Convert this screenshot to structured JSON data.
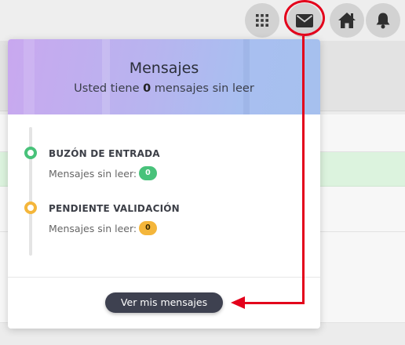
{
  "topbar": {
    "icons": [
      "apps-grid-icon",
      "envelope-icon",
      "home-icon",
      "bell-icon"
    ]
  },
  "messages_panel": {
    "title": "Mensajes",
    "subtitle_prefix": "Usted tiene ",
    "unread_count": "0",
    "subtitle_suffix": " mensajes sin leer",
    "items": [
      {
        "label": "BUZÓN DE ENTRADA",
        "unread_label": "Mensajes sin leer:",
        "count": "0",
        "color": "#48c27a"
      },
      {
        "label": "PENDIENTE VALIDACIÓN",
        "unread_label": "Mensajes sin leer:",
        "count": "0",
        "color": "#f4b63b"
      }
    ],
    "view_button": "Ver mis mensajes"
  },
  "annotation": {
    "color": "#e3001b"
  },
  "colors": {
    "header_gradient_start": "#c9a8ef",
    "header_gradient_end": "#a6c0ee",
    "button_dark": "#3e4150"
  }
}
